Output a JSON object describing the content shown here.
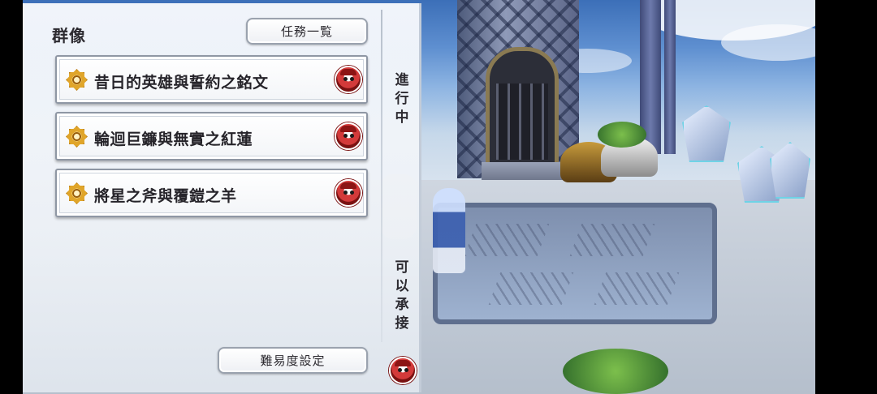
{
  "panel": {
    "title": "群像",
    "quest_list_button": "任務一覧",
    "quests": [
      {
        "label": "昔日的英雄與誓約之銘文"
      },
      {
        "label": "輪迴巨鐮與無實之紅蓮"
      },
      {
        "label": "將星之斧與覆鎧之羊"
      }
    ],
    "tabs": {
      "in_progress": [
        "進",
        "行",
        "中"
      ],
      "available": [
        "可",
        "以",
        "承",
        "接"
      ]
    },
    "difficulty_button": "難易度設定"
  },
  "colors": {
    "panel_bg": "#f4f6fa",
    "badge_red": "#d33a3a",
    "quest_icon_gold": "#e0a52a"
  },
  "icons": {
    "quest": "quest-emblem-icon",
    "character": "character-badge-icon"
  }
}
